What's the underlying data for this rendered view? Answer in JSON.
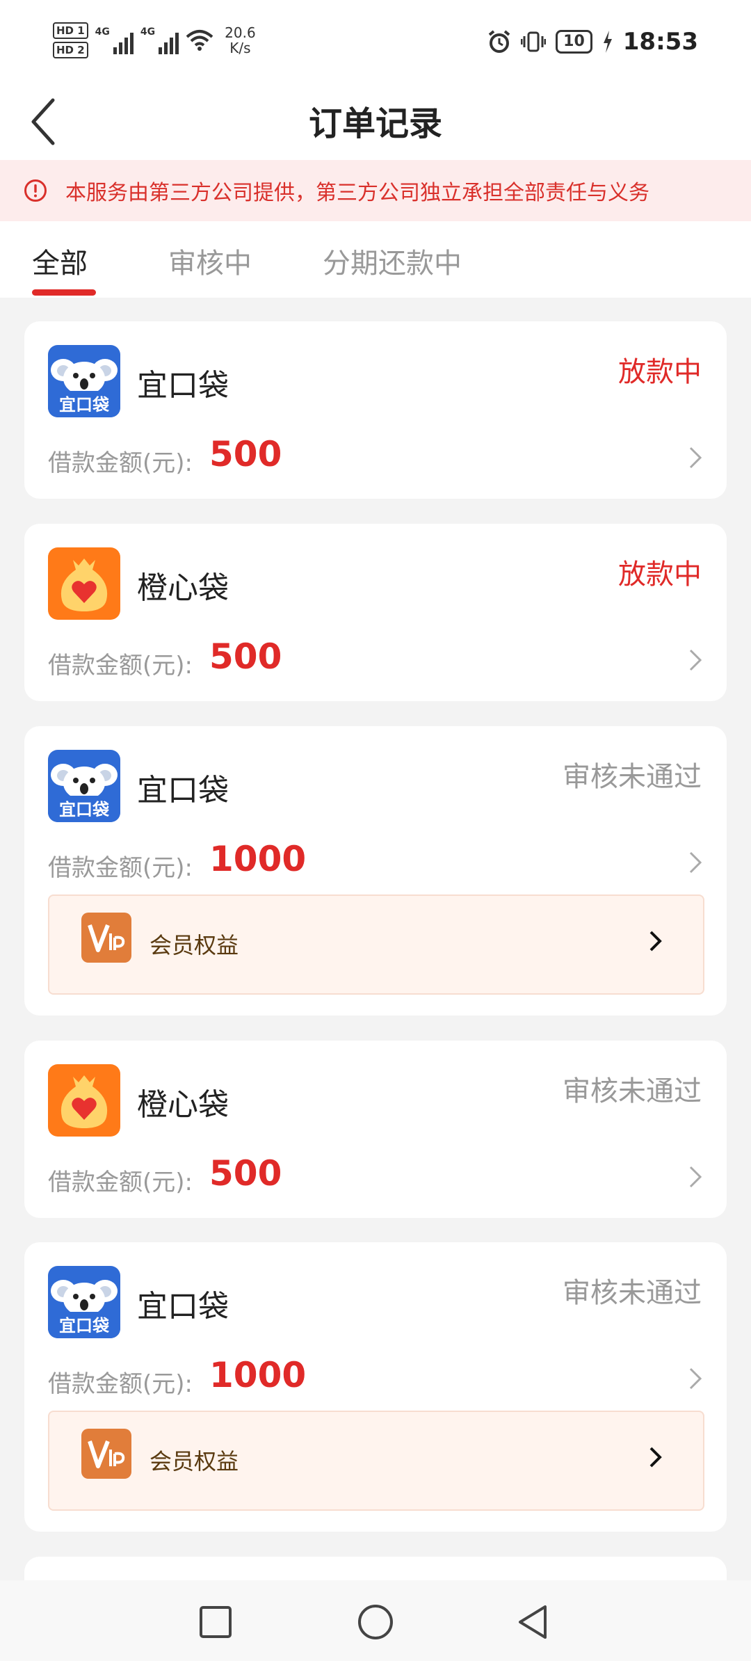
{
  "status_bar": {
    "hd1": "HD 1",
    "hd2": "HD 2",
    "net1": "4G",
    "net2": "4G",
    "speed_value": "20.6",
    "speed_unit": "K/s",
    "battery": "10",
    "time": "18:53",
    "icons": [
      "alarm-icon",
      "vibrate-icon",
      "battery-icon",
      "charging-icon",
      "wifi-icon",
      "signal-icon"
    ]
  },
  "header": {
    "back_icon": "chevron-left-icon",
    "title": "订单记录"
  },
  "notice": {
    "icon": "alert-circle-icon",
    "text": "本服务由第三方公司提供，第三方公司独立承担全部责任与义务"
  },
  "tabs": [
    {
      "label": "全部",
      "active": true
    },
    {
      "label": "审核中",
      "active": false
    },
    {
      "label": "分期还款中",
      "active": false
    }
  ],
  "orders": [
    {
      "name": "宜口袋",
      "logo": "koala-logo",
      "status": "放款中",
      "amount_label": "借款金额(元):",
      "amount": "500"
    },
    {
      "name": "橙心袋",
      "logo": "heart-bag-logo",
      "status": "放款中",
      "amount_label": "借款金额(元):",
      "amount": "500"
    },
    {
      "name": "宜口袋",
      "logo": "koala-logo",
      "status": "审核未通过",
      "amount_label": "借款金额(元):",
      "amount": "1000",
      "vip_label": "会员权益"
    },
    {
      "name": "橙心袋",
      "logo": "heart-bag-logo",
      "status": "审核未通过",
      "amount_label": "借款金额(元):",
      "amount": "500"
    },
    {
      "name": "宜口袋",
      "logo": "koala-logo",
      "status": "审核未通过",
      "amount_label": "借款金额(元):",
      "amount": "1000",
      "vip_label": "会员权益"
    }
  ],
  "koala_logo_text": "宜口袋",
  "colors": {
    "accent_red": "#e02a28",
    "notice_bg": "#fdecec",
    "koala_blue": "#2f6bd6",
    "orange_logo": "#ff7a18",
    "vip_bg": "#fff4ee"
  },
  "nav_bar": {
    "buttons": [
      "recents-square-icon",
      "home-circle-icon",
      "back-triangle-icon"
    ]
  }
}
